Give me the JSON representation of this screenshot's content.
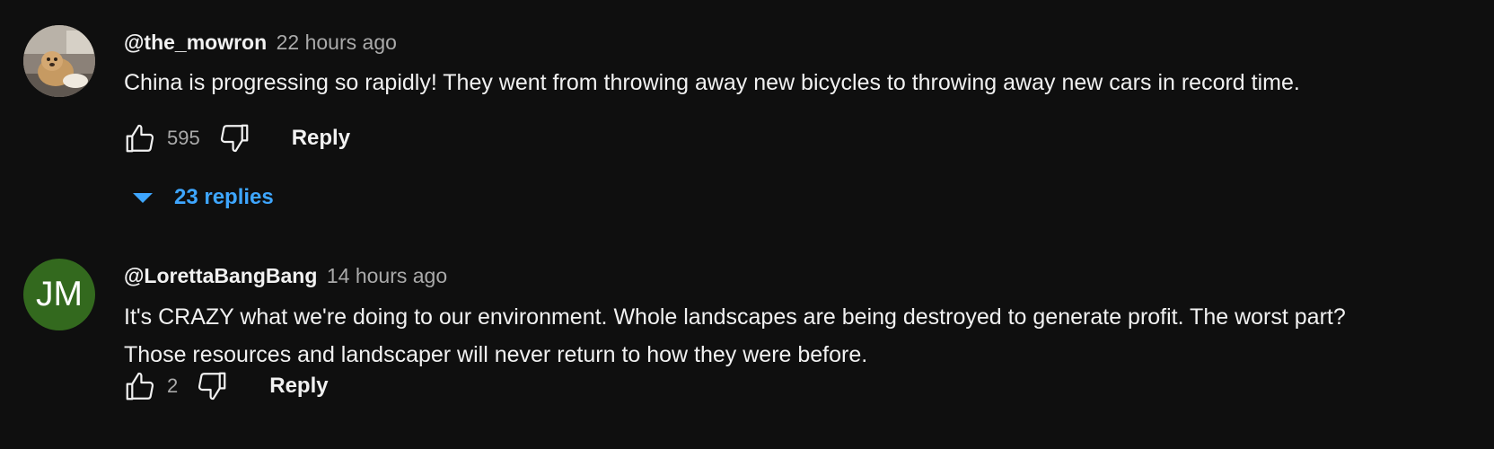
{
  "comments": [
    {
      "author": "@the_mowron",
      "time": "22 hours ago",
      "text": "China is progressing so rapidly! They went from throwing away new bicycles to throwing away new cars in record time.",
      "likes": "595",
      "reply_label": "Reply",
      "replies_label": "23 replies",
      "avatar": "photo"
    },
    {
      "author": "@LorettaBangBang",
      "time": "14 hours ago",
      "text": "It's CRAZY what we're doing to our environment. Whole landscapes are being destroyed to generate profit. The worst part?\nThose resources and landscaper will never return to how they were before.",
      "likes": "2",
      "reply_label": "Reply",
      "avatar_initials": "JM",
      "avatar_color": "#33691e"
    }
  ],
  "colors": {
    "background": "#0f0f0f",
    "primary_text": "#f1f1f1",
    "secondary_text": "#aaaaaa",
    "link_blue": "#3ea6ff"
  },
  "icons": [
    "like-icon",
    "dislike-icon",
    "caret-down-icon"
  ]
}
